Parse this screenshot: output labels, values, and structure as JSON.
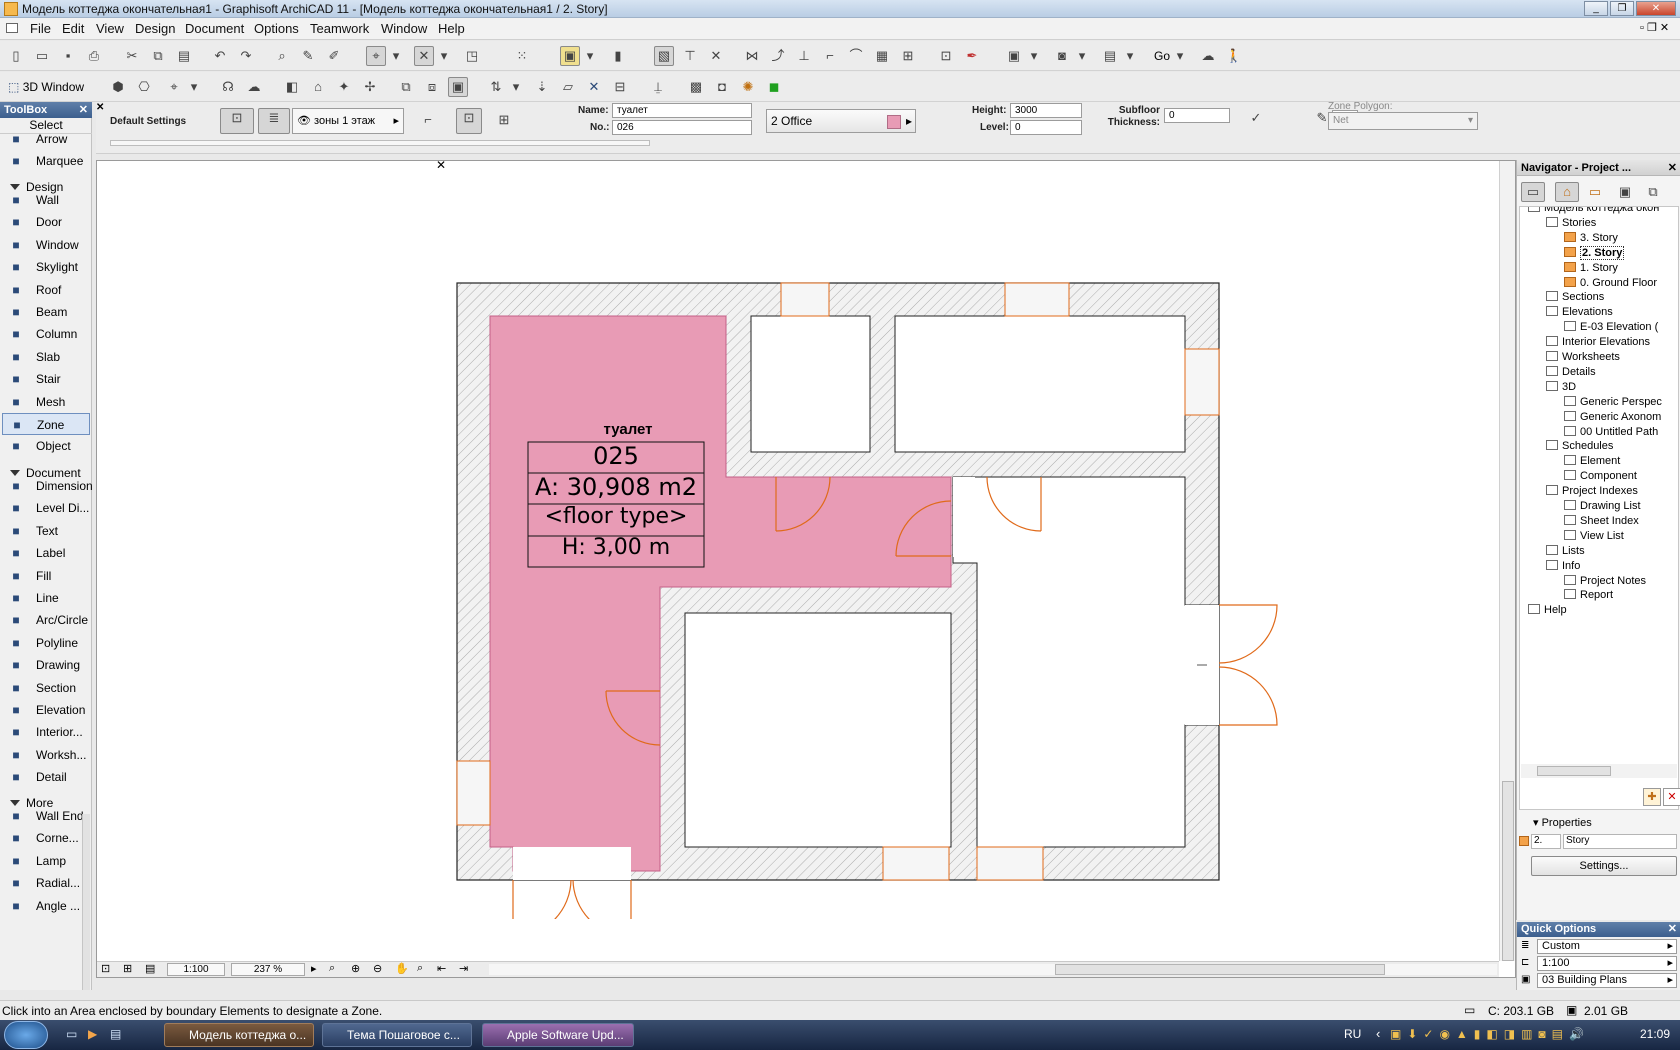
{
  "window": {
    "title": "Модель коттеджа окончательная1 - Graphisoft ArchiCAD 11 - [Модель коттеджа окончательная1 / 2. Story]"
  },
  "menu": [
    "File",
    "Edit",
    "View",
    "Design",
    "Document",
    "Options",
    "Teamwork",
    "Window",
    "Help"
  ],
  "toolbar2": {
    "window3d_label": "3D Window",
    "go_label": "Go"
  },
  "infobox": {
    "default_settings": "Default Settings",
    "layer": "зоны 1 этаж",
    "name_label": "Name:",
    "name_value": "туалет",
    "no_label": "No.:",
    "no_value": "026",
    "category": "2  Office",
    "category_color": "#e89bb5",
    "height_label": "Height:",
    "height_value": "3000",
    "level_label": "Level:",
    "level_value": "0",
    "subfloor_label": "Subfloor",
    "thickness_label": "Thickness:",
    "subfloor_value": "0",
    "pen_value": "1",
    "zone_polygon_label": "Zone Polygon:",
    "zone_polygon_value": "Net"
  },
  "toolbox": {
    "title": "ToolBox",
    "select_label": "Select",
    "select_tools": [
      {
        "label": "Arrow",
        "icon": "arrow-icon"
      },
      {
        "label": "Marquee",
        "icon": "marquee-icon"
      }
    ],
    "design_label": "Design",
    "design_tools": [
      {
        "label": "Wall",
        "icon": "wall-icon"
      },
      {
        "label": "Door",
        "icon": "door-icon"
      },
      {
        "label": "Window",
        "icon": "window-icon"
      },
      {
        "label": "Skylight",
        "icon": "skylight-icon"
      },
      {
        "label": "Roof",
        "icon": "roof-icon"
      },
      {
        "label": "Beam",
        "icon": "beam-icon"
      },
      {
        "label": "Column",
        "icon": "column-icon"
      },
      {
        "label": "Slab",
        "icon": "slab-icon"
      },
      {
        "label": "Stair",
        "icon": "stair-icon"
      },
      {
        "label": "Mesh",
        "icon": "mesh-icon"
      },
      {
        "label": "Zone",
        "icon": "zone-icon"
      },
      {
        "label": "Object",
        "icon": "object-icon"
      }
    ],
    "document_label": "Document",
    "document_tools": [
      {
        "label": "Dimension",
        "icon": "dimension-icon"
      },
      {
        "label": "Level Di...",
        "icon": "level-dimension-icon"
      },
      {
        "label": "Text",
        "icon": "text-icon"
      },
      {
        "label": "Label",
        "icon": "label-icon"
      },
      {
        "label": "Fill",
        "icon": "fill-icon"
      },
      {
        "label": "Line",
        "icon": "line-icon"
      },
      {
        "label": "Arc/Circle",
        "icon": "arc-circle-icon"
      },
      {
        "label": "Polyline",
        "icon": "polyline-icon"
      },
      {
        "label": "Drawing",
        "icon": "drawing-icon"
      },
      {
        "label": "Section",
        "icon": "section-icon"
      },
      {
        "label": "Elevation",
        "icon": "elevation-icon"
      },
      {
        "label": "Interior...",
        "icon": "interior-icon"
      },
      {
        "label": "Worksh...",
        "icon": "worksheet-icon"
      },
      {
        "label": "Detail",
        "icon": "detail-icon"
      }
    ],
    "more_label": "More",
    "more_tools": [
      {
        "label": "Wall End",
        "icon": "wall-end-icon"
      },
      {
        "label": "Corne...",
        "icon": "corner-window-icon"
      },
      {
        "label": "Lamp",
        "icon": "lamp-icon"
      },
      {
        "label": "Radial...",
        "icon": "radial-dimension-icon"
      },
      {
        "label": "Angle ...",
        "icon": "angle-dimension-icon"
      }
    ]
  },
  "zone_stamp": {
    "name": "туалет",
    "number": "025",
    "area": "A: 30,908 m2",
    "floor": "<floor type>",
    "height": "H: 3,00 m",
    "fill_color": "#e89bb5"
  },
  "view_controls": {
    "scale": "1:100",
    "zoom": "237 %"
  },
  "navigator": {
    "title": "Navigator - Project ...",
    "tree": [
      {
        "label": "Модель коттеджа окон",
        "depth": 0,
        "icon": "house-icon"
      },
      {
        "label": "Stories",
        "depth": 1,
        "icon": "stories-icon"
      },
      {
        "label": "3. Story",
        "depth": 2,
        "icon": "story-icon"
      },
      {
        "label": "2. Story",
        "depth": 2,
        "icon": "story-icon",
        "selected": true
      },
      {
        "label": "1. Story",
        "depth": 2,
        "icon": "story-icon"
      },
      {
        "label": "0. Ground Floor",
        "depth": 2,
        "icon": "story-icon"
      },
      {
        "label": "Sections",
        "depth": 1,
        "icon": "sections-icon"
      },
      {
        "label": "Elevations",
        "depth": 1,
        "icon": "elevations-icon"
      },
      {
        "label": "E-03 Elevation (",
        "depth": 2,
        "icon": "elevation-icon"
      },
      {
        "label": "Interior Elevations",
        "depth": 1,
        "icon": "interior-elevations-icon"
      },
      {
        "label": "Worksheets",
        "depth": 1,
        "icon": "worksheets-icon"
      },
      {
        "label": "Details",
        "depth": 1,
        "icon": "details-icon"
      },
      {
        "label": "3D",
        "depth": 1,
        "icon": "3d-icon"
      },
      {
        "label": "Generic Perspec",
        "depth": 2,
        "icon": "perspective-icon"
      },
      {
        "label": "Generic Axonom",
        "depth": 2,
        "icon": "axonometry-icon"
      },
      {
        "label": "00 Untitled Path",
        "depth": 2,
        "icon": "path-icon"
      },
      {
        "label": "Schedules",
        "depth": 1,
        "icon": "schedules-icon"
      },
      {
        "label": "Element",
        "depth": 2,
        "icon": "element-schedule-icon"
      },
      {
        "label": "Component",
        "depth": 2,
        "icon": "component-schedule-icon"
      },
      {
        "label": "Project Indexes",
        "depth": 1,
        "icon": "project-indexes-icon"
      },
      {
        "label": "Drawing List",
        "depth": 2,
        "icon": "drawing-list-icon"
      },
      {
        "label": "Sheet Index",
        "depth": 2,
        "icon": "sheet-index-icon"
      },
      {
        "label": "View List",
        "depth": 2,
        "icon": "view-list-icon"
      },
      {
        "label": "Lists",
        "depth": 1,
        "icon": "lists-icon"
      },
      {
        "label": "Info",
        "depth": 1,
        "icon": "info-icon"
      },
      {
        "label": "Project Notes",
        "depth": 2,
        "icon": "project-notes-icon"
      },
      {
        "label": "Report",
        "depth": 2,
        "icon": "report-icon"
      },
      {
        "label": "Help",
        "depth": 0,
        "icon": "help-icon"
      }
    ],
    "properties_label": "Properties",
    "prop_number": "2.",
    "prop_name": "Story",
    "settings_label": "Settings..."
  },
  "quick_options": {
    "title": "Quick Options",
    "items": [
      "Custom",
      "1:100",
      "03 Building Plans"
    ]
  },
  "status": {
    "hint": "Click into an Area enclosed by boundary Elements to designate a Zone.",
    "disk": "C: 203.1 GB",
    "memory": "2.01 GB"
  },
  "taskbar": {
    "tasks": [
      "Модель коттеджа о...",
      "Тема Пошаговое с...",
      "Apple Software Upd..."
    ],
    "lang": "RU",
    "clock": "21:09"
  }
}
